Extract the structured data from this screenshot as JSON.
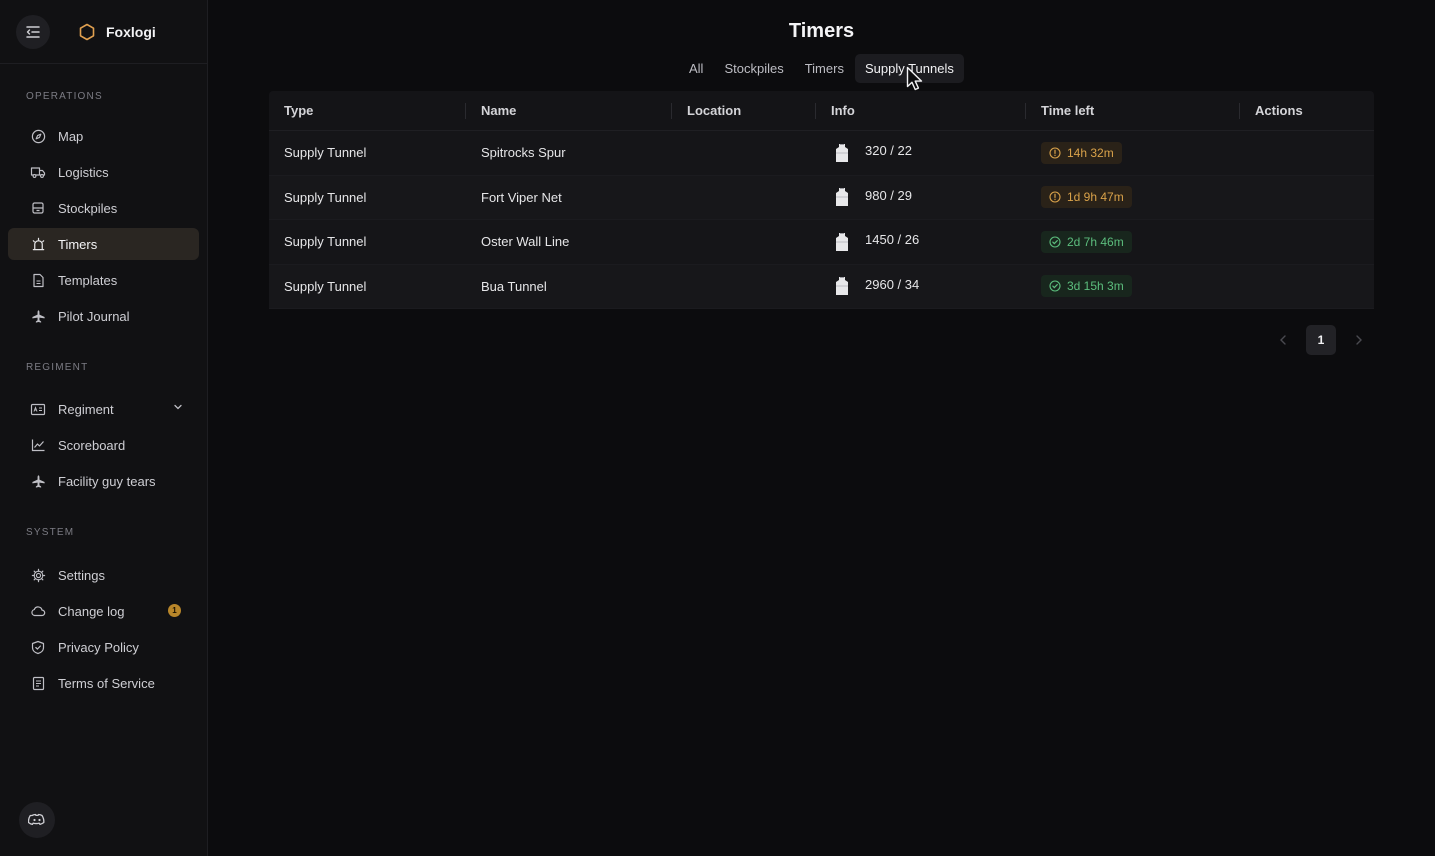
{
  "app": {
    "name": "Foxlogi"
  },
  "sidebar": {
    "sections": [
      {
        "label": "OPERATIONS",
        "items": [
          {
            "label": "Map",
            "icon": "compass-icon"
          },
          {
            "label": "Logistics",
            "icon": "truck-icon"
          },
          {
            "label": "Stockpiles",
            "icon": "box-icon"
          },
          {
            "label": "Timers",
            "icon": "alarm-icon",
            "active": true
          },
          {
            "label": "Templates",
            "icon": "file-icon"
          },
          {
            "label": "Pilot Journal",
            "icon": "plane-icon"
          }
        ]
      },
      {
        "label": "REGIMENT",
        "items": [
          {
            "label": "Regiment",
            "icon": "id-card-icon",
            "expandable": true
          },
          {
            "label": "Scoreboard",
            "icon": "chart-line-icon"
          },
          {
            "label": "Facility guy tears",
            "icon": "plane-icon"
          }
        ]
      },
      {
        "label": "SYSTEM",
        "items": [
          {
            "label": "Settings",
            "icon": "gear-icon"
          },
          {
            "label": "Change log",
            "icon": "cloud-icon",
            "badge": "1"
          },
          {
            "label": "Privacy Policy",
            "icon": "shield-check-icon"
          },
          {
            "label": "Terms of Service",
            "icon": "document-list-icon"
          }
        ]
      }
    ]
  },
  "page": {
    "title": "Timers",
    "tabs": [
      {
        "label": "All"
      },
      {
        "label": "Stockpiles"
      },
      {
        "label": "Timers"
      },
      {
        "label": "Supply Tunnels",
        "active": true
      }
    ]
  },
  "table": {
    "columns": [
      "Type",
      "Name",
      "Location",
      "Info",
      "Time left",
      "Actions"
    ],
    "rows": [
      {
        "type": "Supply Tunnel",
        "name": "Spitrocks Spur",
        "location": "",
        "info": "320 / 22",
        "time_left": "14h 32m",
        "status": "warn"
      },
      {
        "type": "Supply Tunnel",
        "name": "Fort Viper Net",
        "location": "",
        "info": "980 / 29",
        "time_left": "1d 9h 47m",
        "status": "warn"
      },
      {
        "type": "Supply Tunnel",
        "name": "Oster Wall Line",
        "location": "",
        "info": "1450 / 26",
        "time_left": "2d 7h 46m",
        "status": "ok"
      },
      {
        "type": "Supply Tunnel",
        "name": "Bua Tunnel",
        "location": "",
        "info": "2960 / 34",
        "time_left": "3d 15h 3m",
        "status": "ok"
      }
    ]
  },
  "pagination": {
    "current_page": "1"
  },
  "colors": {
    "accent": "#e0a050",
    "warn": "#d9a24a",
    "ok": "#5cbd7d",
    "active_nav_bg": "#2a2622"
  }
}
